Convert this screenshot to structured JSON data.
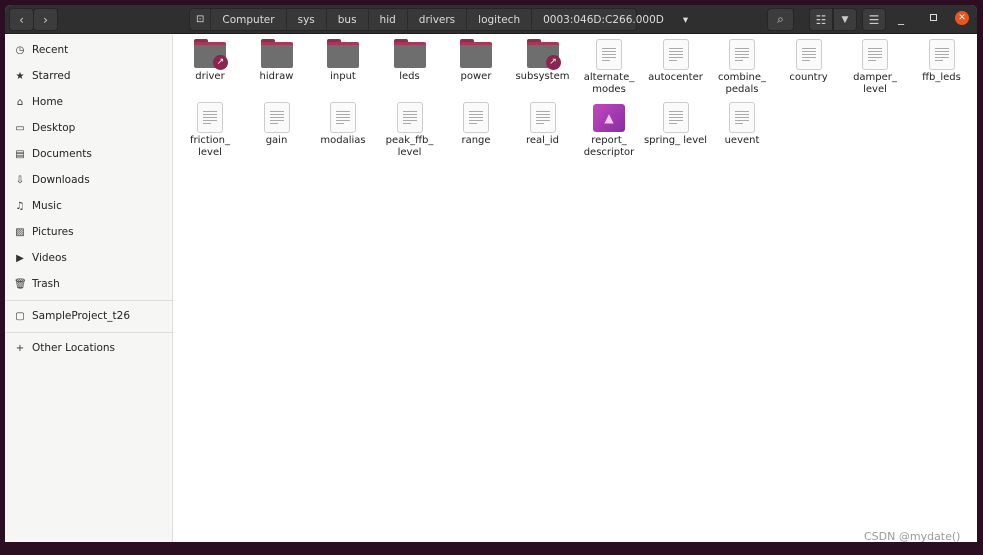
{
  "header": {
    "back": "‹",
    "forward": "›",
    "path": [
      "Computer",
      "sys",
      "bus",
      "hid",
      "drivers",
      "logitech",
      "0003:046D:C266.000D"
    ],
    "search": "search-icon",
    "view": "list-view-icon",
    "menu": "hamburger-menu-icon"
  },
  "sidebar": {
    "items": [
      {
        "label": "Recent",
        "icon": "◷"
      },
      {
        "label": "Starred",
        "icon": "★"
      },
      {
        "label": "Home",
        "icon": "⌂"
      },
      {
        "label": "Desktop",
        "icon": "▭"
      },
      {
        "label": "Documents",
        "icon": "▤"
      },
      {
        "label": "Downloads",
        "icon": "⇩"
      },
      {
        "label": "Music",
        "icon": "♫"
      },
      {
        "label": "Pictures",
        "icon": "▨"
      },
      {
        "label": "Videos",
        "icon": "▶"
      },
      {
        "label": "Trash",
        "icon": "🗑"
      }
    ],
    "bookmarks": [
      {
        "label": "SampleProject_t26",
        "icon": "▢"
      }
    ],
    "other": {
      "label": "Other Locations",
      "icon": "+"
    }
  },
  "files": [
    {
      "name": "driver",
      "type": "folder-link"
    },
    {
      "name": "hidraw",
      "type": "folder"
    },
    {
      "name": "input",
      "type": "folder"
    },
    {
      "name": "leds",
      "type": "folder"
    },
    {
      "name": "power",
      "type": "folder"
    },
    {
      "name": "subsystem",
      "type": "folder-link"
    },
    {
      "name": "alternate_ modes",
      "type": "text"
    },
    {
      "name": "autocenter",
      "type": "text"
    },
    {
      "name": "combine_ pedals",
      "type": "text"
    },
    {
      "name": "country",
      "type": "text"
    },
    {
      "name": "damper_ level",
      "type": "text"
    },
    {
      "name": "ffb_leds",
      "type": "text"
    },
    {
      "name": "friction_ level",
      "type": "text"
    },
    {
      "name": "gain",
      "type": "text"
    },
    {
      "name": "modalias",
      "type": "text"
    },
    {
      "name": "peak_ffb_ level",
      "type": "text"
    },
    {
      "name": "range",
      "type": "text"
    },
    {
      "name": "real_id",
      "type": "text"
    },
    {
      "name": "report_ descriptor",
      "type": "image"
    },
    {
      "name": "spring_ level",
      "type": "text"
    },
    {
      "name": "uevent",
      "type": "text"
    }
  ],
  "watermark": "CSDN @mydate()",
  "colors": {
    "close": "#e95420",
    "folder": "#6e6e6e",
    "folder_accent": "#a8385a"
  }
}
